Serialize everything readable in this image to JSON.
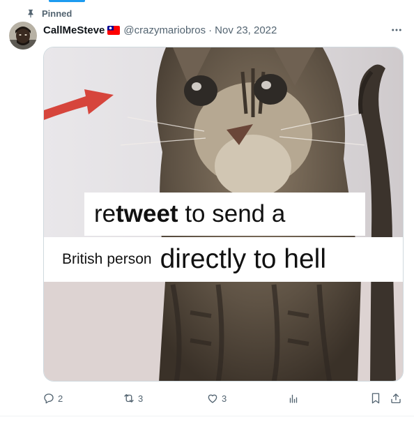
{
  "post": {
    "pinned_label": "Pinned",
    "author": {
      "display_name": "CallMeSteve",
      "handle": "@crazymariobros",
      "separator": "·",
      "date": "Nov 23, 2022",
      "flag": "taiwan-flag-icon"
    },
    "media": {
      "meme": {
        "line1_prefix": "re",
        "line1_bold": "tweet",
        "line1_rest": "to send a",
        "line2_word1": "British",
        "line2_word2": "person",
        "line2_rest": "directly to hell"
      }
    },
    "actions": {
      "replies": "2",
      "reposts": "3",
      "likes": "3"
    }
  },
  "icons": [
    "pin-icon",
    "more-icon",
    "reply-icon",
    "repost-icon",
    "like-icon",
    "views-icon",
    "bookmark-icon",
    "share-icon"
  ],
  "colors": {
    "accent": "#1d9bf0",
    "secondary_text": "#536471",
    "primary_text": "#0f1419",
    "border": "#cfd9de"
  }
}
